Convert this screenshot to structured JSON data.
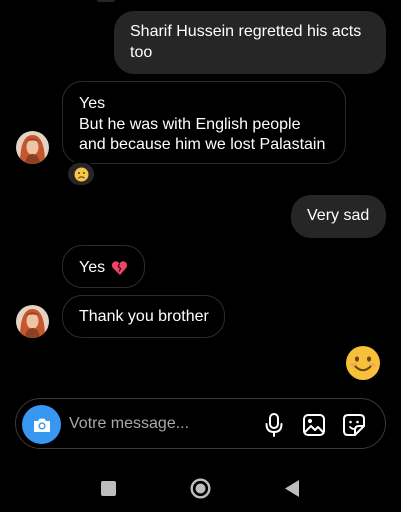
{
  "conversation": {
    "messages": [
      {
        "direction": "sent",
        "text": "Sharif Hussein regretted his acts too"
      },
      {
        "direction": "received",
        "lines": [
          "Yes",
          "But he was with English people",
          "and because him we lost Palastain"
        ],
        "reaction": "sad-face"
      },
      {
        "direction": "sent",
        "text": "Very sad"
      },
      {
        "direction": "received",
        "text": "Yes",
        "emoji": "broken-heart"
      },
      {
        "direction": "received",
        "text": "Thank you brother"
      },
      {
        "direction": "sent",
        "emoji": "smiling-face"
      }
    ]
  },
  "composer": {
    "placeholder": "Votre message..."
  },
  "colors": {
    "background": "#000000",
    "sent_bubble": "#262626",
    "received_border": "#2c2c2c",
    "camera_button": "#3897f0"
  },
  "icons": {
    "camera": "camera-icon",
    "mic": "microphone-icon",
    "gallery": "gallery-icon",
    "sticker": "sticker-icon",
    "nav_recents": "square-icon",
    "nav_home": "circle-icon",
    "nav_back": "triangle-icon"
  }
}
